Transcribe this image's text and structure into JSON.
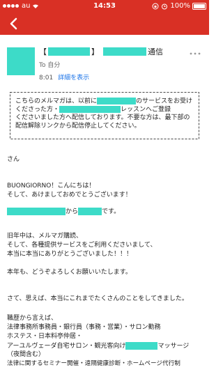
{
  "status_bar": {
    "carrier": "au",
    "time": "14:53",
    "battery": "100%"
  },
  "colors": {
    "brand": "#d93025",
    "redaction": "#3ddbc8",
    "link": "#1a73e8"
  },
  "toolbar": {
    "back": "arrow-back-icon",
    "archive": "archive-icon",
    "delete": "trash-icon",
    "mail": "mail-icon",
    "more": "more-vert-icon"
  },
  "email": {
    "subject_open": "【",
    "subject_close": "】",
    "subject_suffix": "通信",
    "to": "To 自分",
    "time": "8:01",
    "details_link": "詳細を表示"
  },
  "notice": {
    "line1_a": "こちらのメルマガは、以前に",
    "line1_b": "のサービスをお受け",
    "line2_a": "くださった方・",
    "line2_b": "レッスンへご登録",
    "line3": "くださいました方へ配信しております。不要な方は、最下部の",
    "line4": "配信解除リンクから配信停止してください。"
  },
  "body": {
    "salutation": "さん",
    "greeting_1": "BUONGIORNO！こんにちは！",
    "greeting_2": "そして、あけましておめでとうございます！",
    "from_mid": "から",
    "from_end": "です。",
    "p1_1": "旧年中は、メルマガ購読、",
    "p1_2": "そして、各種提供サービスをご利用くださいまして、",
    "p1_3": "本当に本当にありがとうございました！！！",
    "p2": "本年も、どうぞよろしくお願いいたします。",
    "p3": "さて、思えば、本当にこれまでたくさんのことをしてきました。",
    "p4_1": "職歴から言えば、",
    "p4_2": "法律事務所事務員・銀行員（事務・営業）・サロン勤務",
    "p4_3": "ホステス・日本料亭仲居・",
    "p4_4a": "アーユルヴェーダ自宅サロン・観光客向け",
    "p4_4b": "マッサージ",
    "p4_5": "（夜間含む）",
    "p4_6": "法律に関するセミナー開催・遠隔健康診断・ホームページ代行制"
  }
}
